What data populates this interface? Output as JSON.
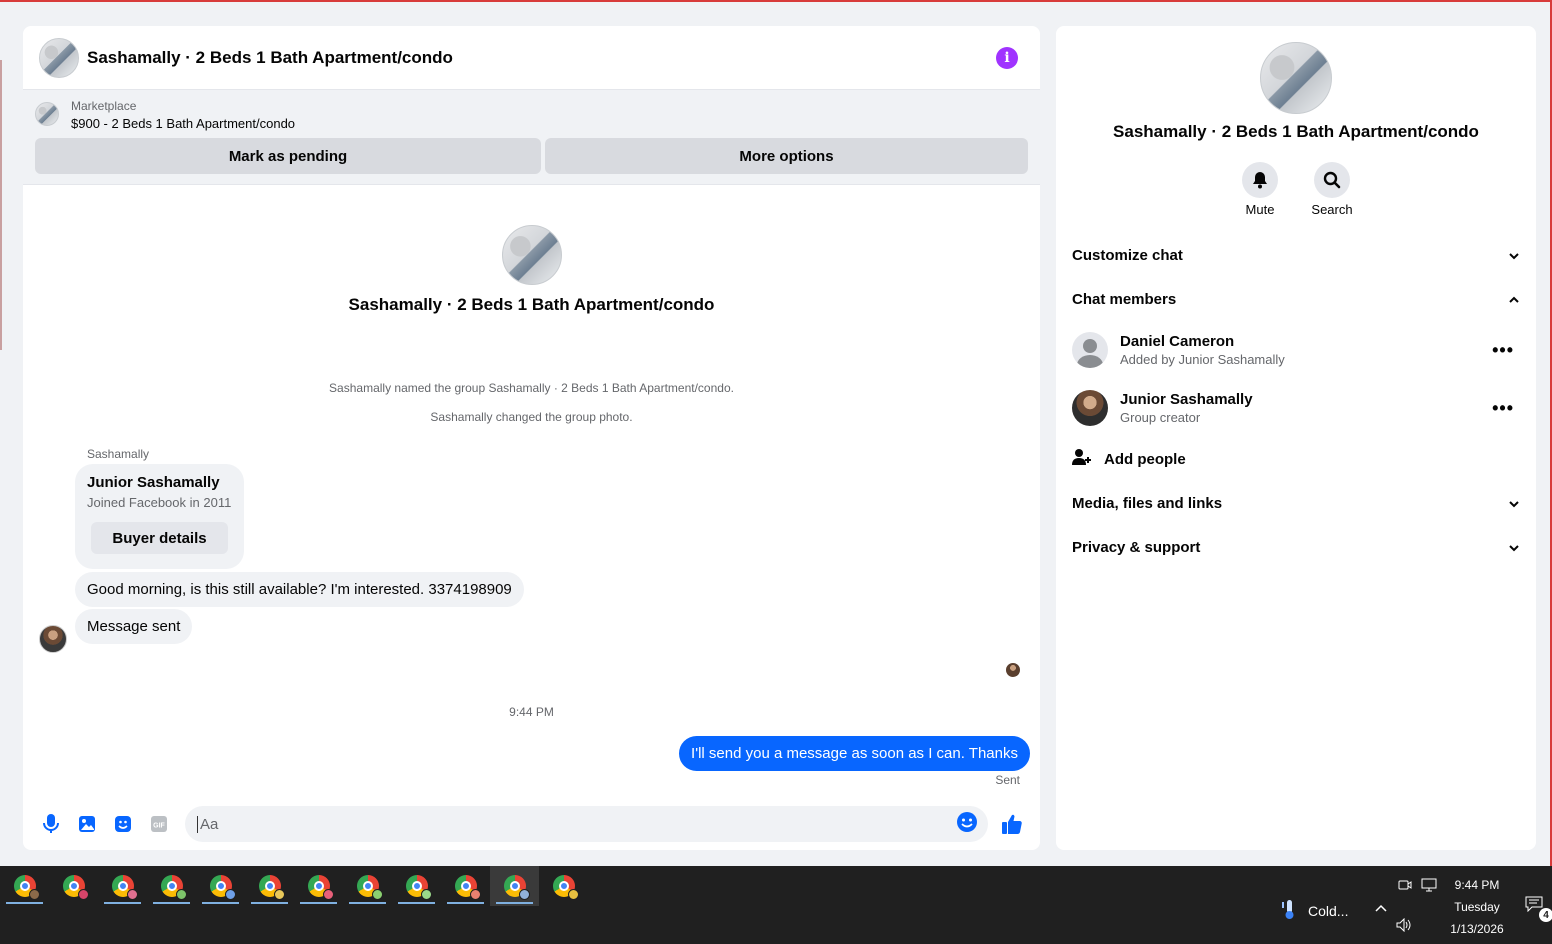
{
  "chat": {
    "title": "Sashamally · 2 Beds 1 Bath Apartment/condo",
    "marketplace": {
      "label": "Marketplace",
      "item": "$900 - 2 Beds 1 Bath Apartment/condo",
      "pending_button": "Mark as pending",
      "more_button": "More options"
    },
    "intro_name": "Sashamally · 2 Beds 1 Bath Apartment/condo",
    "system_messages": [
      "Sashamally named the group Sashamally · 2 Beds 1 Bath Apartment/condo.",
      "Sashamally changed the group photo."
    ],
    "sender_name": "Sashamally",
    "buyer_card": {
      "name": "Junior Sashamally",
      "subtitle": "Joined Facebook in 2011",
      "button": "Buyer details"
    },
    "messages": {
      "incoming_1": "Good morning, is this still available? I'm interested. 3374198909",
      "incoming_2": "Message sent",
      "timestamp": "9:44 PM",
      "outgoing_1": "I'll send you a message as soon as I can. Thanks",
      "status": "Sent"
    },
    "composer": {
      "placeholder": "Aa",
      "icons": [
        "microphone-icon",
        "image-icon",
        "sticker-icon",
        "gif-icon",
        "emoji-icon",
        "thumbs-up-icon"
      ],
      "gif_label": "GIF"
    }
  },
  "details": {
    "title": "Sashamally · 2 Beds 1 Bath Apartment/condo",
    "actions": [
      {
        "label": "Mute",
        "icon": "bell-icon"
      },
      {
        "label": "Search",
        "icon": "search-icon"
      }
    ],
    "sections": {
      "customize": "Customize chat",
      "members": "Chat members",
      "media": "Media, files and links",
      "privacy": "Privacy & support"
    },
    "members": [
      {
        "name": "Daniel Cameron",
        "subtitle": "Added by Junior Sashamally"
      },
      {
        "name": "Junior Sashamally",
        "subtitle": "Group creator"
      }
    ],
    "add_people": "Add people",
    "more_glyph": "•••"
  },
  "taskbar": {
    "weather": "Cold...",
    "time": "9:44 PM",
    "day": "Tuesday",
    "date": "1/13/2026",
    "notification_count": "4"
  },
  "colors": {
    "messenger_blue": "#0866ff",
    "info_purple": "#a033ff",
    "background": "#f0f2f5"
  }
}
